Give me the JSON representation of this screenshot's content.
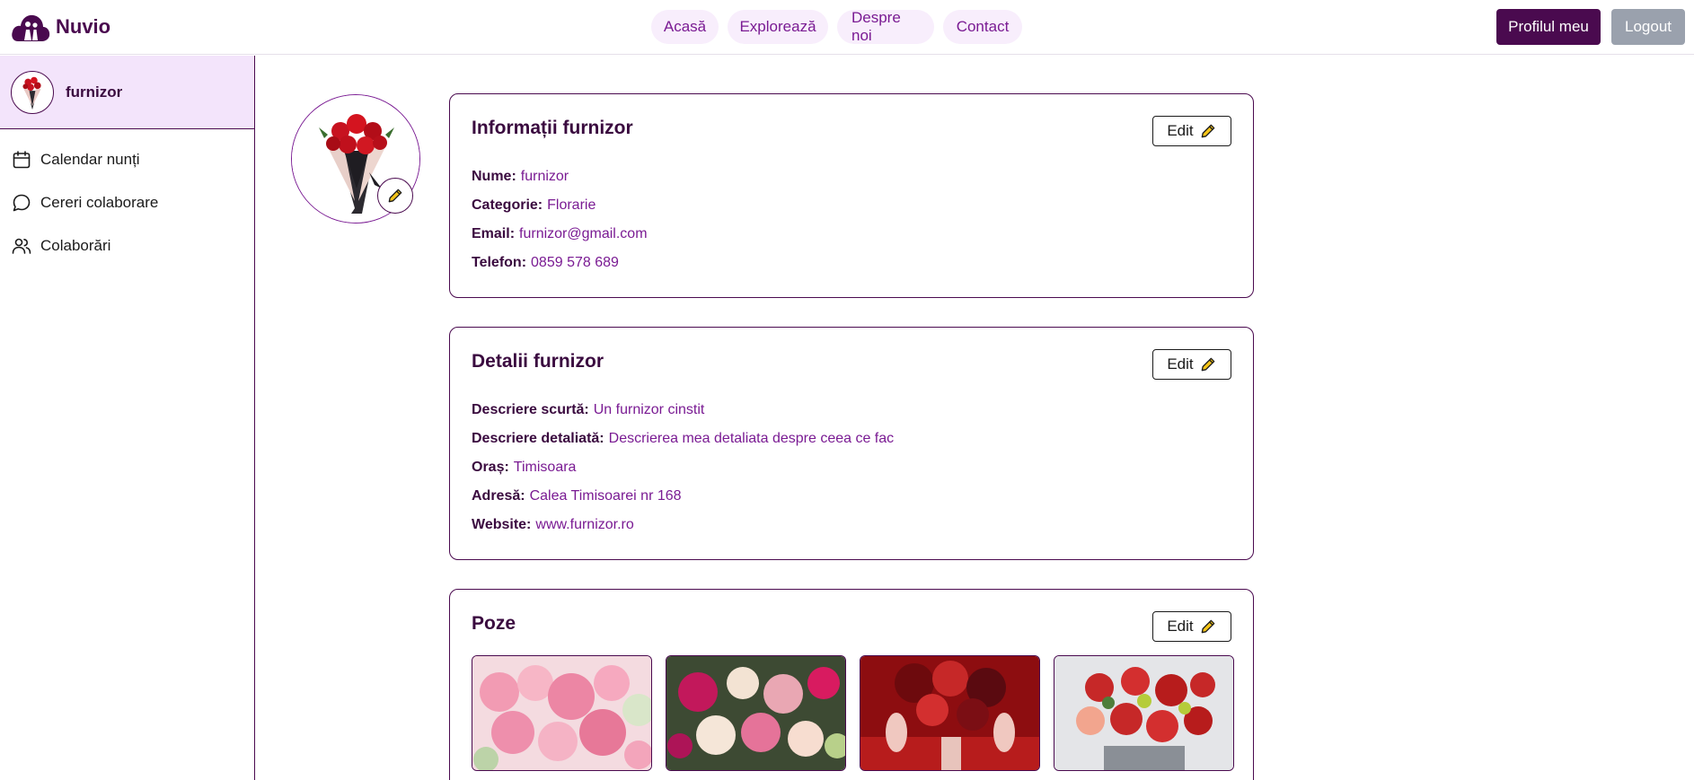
{
  "header": {
    "logo_text": "Nuvio",
    "nav": [
      "Acasă",
      "Explorează",
      "Despre noi",
      "Contact"
    ],
    "profile_btn": "Profilul meu",
    "logout_btn": "Logout"
  },
  "sidebar": {
    "username": "furnizor",
    "items": [
      "Calendar nunți",
      "Cereri colaborare",
      "Colaborări"
    ]
  },
  "info": {
    "title": "Informații furnizor",
    "edit": "Edit",
    "rows": [
      {
        "label": "Nume:",
        "value": "furnizor"
      },
      {
        "label": "Categorie:",
        "value": "Florarie"
      },
      {
        "label": "Email:",
        "value": "furnizor@gmail.com"
      },
      {
        "label": "Telefon:",
        "value": "0859 578 689"
      }
    ]
  },
  "details": {
    "title": "Detalii furnizor",
    "edit": "Edit",
    "rows": [
      {
        "label": "Descriere scurtă:",
        "value": "Un furnizor cinstit"
      },
      {
        "label": "Descriere detaliată:",
        "value": "Descrierea mea detaliata despre ceea ce fac"
      },
      {
        "label": "Oraș:",
        "value": "Timisoara"
      },
      {
        "label": "Adresă:",
        "value": "Calea Timisoarei nr 168"
      },
      {
        "label": "Website:",
        "value": "www.furnizor.ro"
      }
    ]
  },
  "photos": {
    "title": "Poze",
    "edit": "Edit"
  },
  "colors": {
    "brand": "#4a0a4f",
    "accent": "#7a1b93",
    "sidebar_active": "#f3e4fb",
    "logout": "#9aa1ad"
  }
}
